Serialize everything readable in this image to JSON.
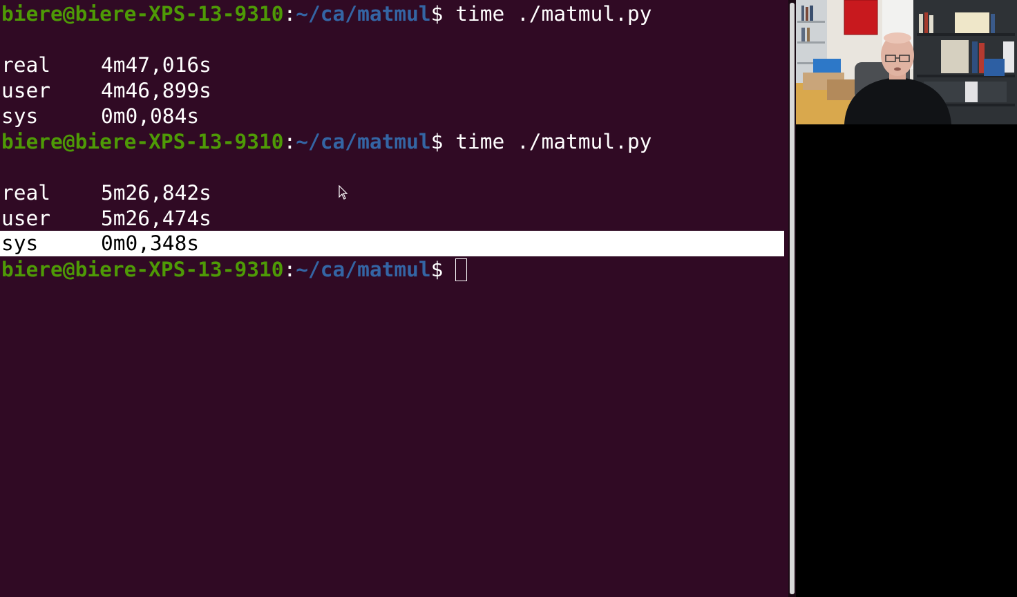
{
  "terminal": {
    "prompt": {
      "user_host": "biere@biere-XPS-13-9310",
      "colon": ":",
      "path": "~/ca/matmul",
      "dollar": "$"
    },
    "run1": {
      "command": " time ./matmul.py",
      "real_label": "real",
      "real_value": "4m47,016s",
      "user_label": "user",
      "user_value": "4m46,899s",
      "sys_label": "sys",
      "sys_value": "0m0,084s"
    },
    "run2": {
      "command": " time ./matmul.py",
      "real_label": "real",
      "real_value": "5m26,842s",
      "user_label": "user",
      "user_value": "5m26,474s",
      "sys_label": "sys",
      "sys_value": "0m0,348s"
    }
  },
  "colors": {
    "background": "#300a24",
    "user_host": "#4e9a06",
    "path": "#3465a4",
    "text": "#ffffff",
    "selection": "#ffffff"
  }
}
